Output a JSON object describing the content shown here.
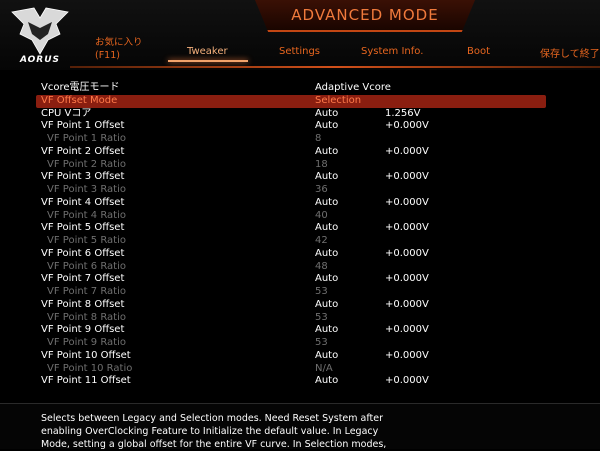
{
  "header": {
    "logo_text": "AORUS",
    "mode_title": "ADVANCED MODE",
    "tabs": {
      "favorites_line1": "お気に入り",
      "favorites_line2": "(F11)",
      "tweaker": "Tweaker",
      "settings": "Settings",
      "system_info": "System Info.",
      "boot": "Boot",
      "save_exit": "保存して終了"
    }
  },
  "rows": [
    {
      "label": "Vcore電圧モード",
      "val1": "Adaptive Vcore",
      "val2": ""
    },
    {
      "label": "VF Offset Mode",
      "val1": "Selection",
      "val2": ""
    },
    {
      "label": "CPU Vコア",
      "val1": "Auto",
      "val2": "1.256V"
    },
    {
      "label": "VF Point 1 Offset",
      "val1": "Auto",
      "val2": "+0.000V"
    },
    {
      "label": "VF Point 1 Ratio",
      "val1": "8",
      "val2": ""
    },
    {
      "label": "VF Point 2 Offset",
      "val1": "Auto",
      "val2": "+0.000V"
    },
    {
      "label": "VF Point 2 Ratio",
      "val1": "18",
      "val2": ""
    },
    {
      "label": "VF Point 3 Offset",
      "val1": "Auto",
      "val2": "+0.000V"
    },
    {
      "label": "VF Point 3 Ratio",
      "val1": "36",
      "val2": ""
    },
    {
      "label": "VF Point 4 Offset",
      "val1": "Auto",
      "val2": "+0.000V"
    },
    {
      "label": "VF Point 4 Ratio",
      "val1": "40",
      "val2": ""
    },
    {
      "label": "VF Point 5 Offset",
      "val1": "Auto",
      "val2": "+0.000V"
    },
    {
      "label": "VF Point 5 Ratio",
      "val1": "42",
      "val2": ""
    },
    {
      "label": "VF Point 6 Offset",
      "val1": "Auto",
      "val2": "+0.000V"
    },
    {
      "label": "VF Point 6 Ratio",
      "val1": "48",
      "val2": ""
    },
    {
      "label": "VF Point 7 Offset",
      "val1": "Auto",
      "val2": "+0.000V"
    },
    {
      "label": "VF Point 7 Ratio",
      "val1": "53",
      "val2": ""
    },
    {
      "label": "VF Point 8 Offset",
      "val1": "Auto",
      "val2": "+0.000V"
    },
    {
      "label": "VF Point 8 Ratio",
      "val1": "53",
      "val2": ""
    },
    {
      "label": "VF Point 9 Offset",
      "val1": "Auto",
      "val2": "+0.000V"
    },
    {
      "label": "VF Point 9 Ratio",
      "val1": "53",
      "val2": ""
    },
    {
      "label": "VF Point 10 Offset",
      "val1": "Auto",
      "val2": "+0.000V"
    },
    {
      "label": "VF Point 10 Ratio",
      "val1": "N/A",
      "val2": ""
    },
    {
      "label": "VF Point 11 Offset",
      "val1": "Auto",
      "val2": "+0.000V"
    }
  ],
  "help": {
    "line1": "Selects between Legacy and Selection modes. Need Reset System after",
    "line2": "enabling OverClocking Feature to Initialize the default value. In Legacy",
    "line3": "Mode, setting a global offset for the entire VF curve. In Selection modes,"
  },
  "colors": {
    "accent": "#e8661f",
    "selected_bg": "#8a1e10",
    "selected_text": "#ff7a4a",
    "dim_text": "#6f6f6f"
  }
}
